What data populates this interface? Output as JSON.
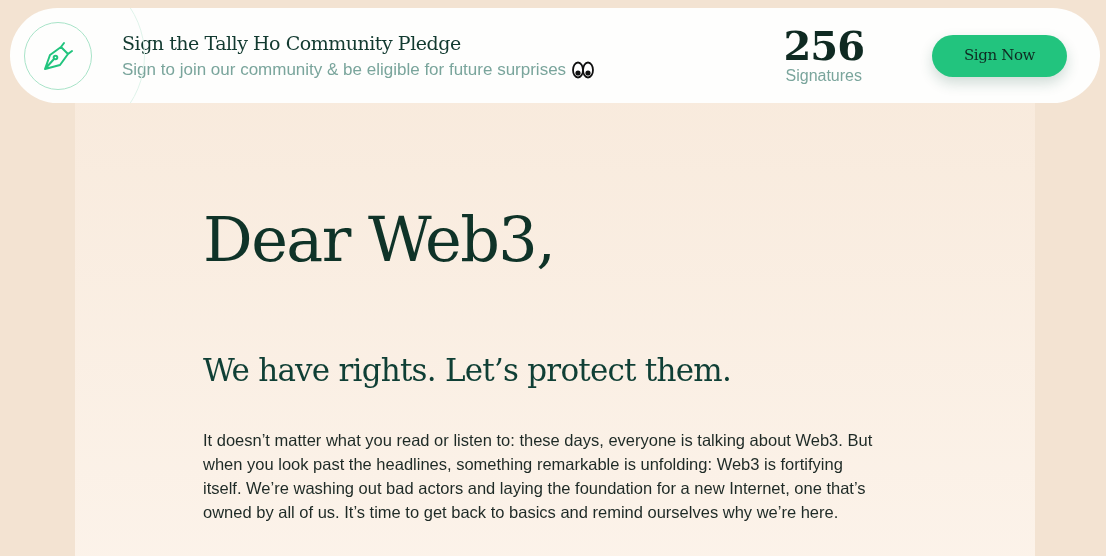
{
  "pledge_banner": {
    "title": "Sign the Tally Ho Community Pledge",
    "subtitle": "Sign to join our community & be eligible for future surprises",
    "count": "256",
    "count_label": "Signatures",
    "button": "Sign Now"
  },
  "letter": {
    "greeting": "Dear Web3,",
    "heading": "We have rights. Let’s protect them.",
    "paragraph": "It doesn’t matter what you read or listen to: these days, everyone is talking about Web3. But when you look past the headlines, something remarkable is unfolding: Web3 is fortifying itself. We’re washing out bad actors and laying the foundation for a new Internet, one that’s owned by all of us. It’s time to get back to basics and remind ourselves why we’re here."
  }
}
